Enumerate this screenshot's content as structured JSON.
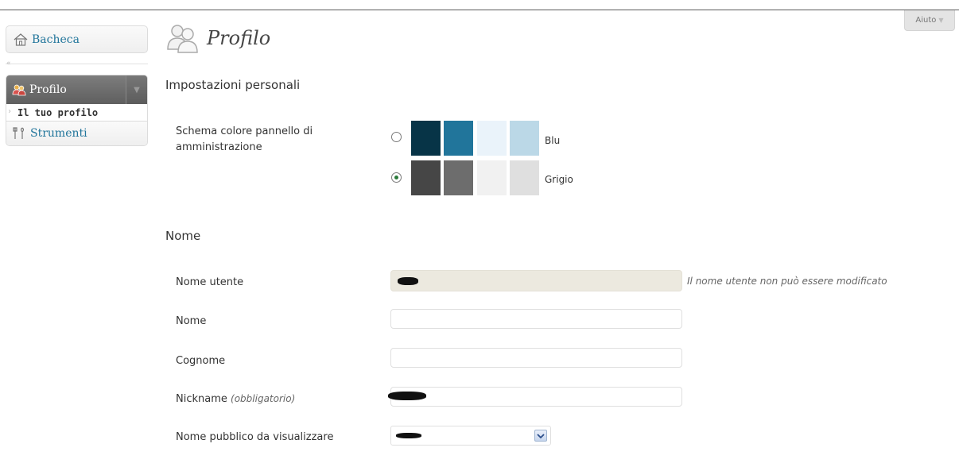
{
  "help": {
    "label": "Aiuto"
  },
  "sidebar": {
    "bacheca": "Bacheca",
    "profilo": "Profilo",
    "profilo_sub": "Il tuo profilo",
    "strumenti": "Strumenti"
  },
  "page": {
    "title": "Profilo"
  },
  "personal_settings": {
    "title": "Impostazioni personali",
    "color_scheme_label_line1": "Schema colore pannello di",
    "color_scheme_label_line2": "amministrazione",
    "schemes": [
      {
        "name": "Blu",
        "selected": false,
        "colors": [
          "#073447",
          "#21759b",
          "#eaf3fa",
          "#bbd8e7"
        ]
      },
      {
        "name": "Grigio",
        "selected": true,
        "colors": [
          "#464646",
          "#6d6d6d",
          "#f1f1f1",
          "#dfdfdf"
        ]
      }
    ]
  },
  "name_section": {
    "title": "Nome",
    "username_label": "Nome utente",
    "username_note": "Il nome utente non può essere modificato",
    "first_name_label": "Nome",
    "last_name_label": "Cognome",
    "nickname_label": "Nickname",
    "nickname_required": "(obbligatorio)",
    "display_name_label": "Nome pubblico da visualizzare"
  }
}
